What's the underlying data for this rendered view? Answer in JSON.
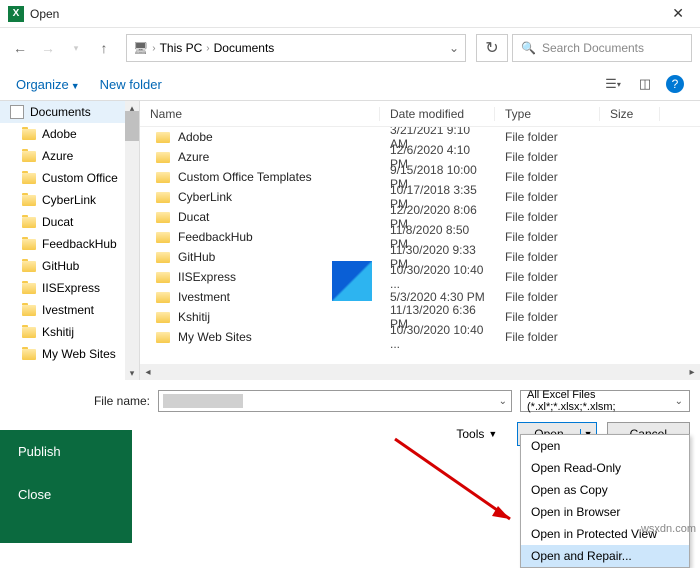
{
  "title": "Open",
  "breadcrumb": {
    "root": "This PC",
    "current": "Documents"
  },
  "search_placeholder": "Search Documents",
  "toolbar": {
    "organize": "Organize",
    "new_folder": "New folder"
  },
  "sidebar": {
    "root": "Documents",
    "items": [
      "Adobe",
      "Azure",
      "Custom Office",
      "CyberLink",
      "Ducat",
      "FeedbackHub",
      "GitHub",
      "IISExpress",
      "Ivestment",
      "Kshitij",
      "My Web Sites"
    ]
  },
  "columns": {
    "name": "Name",
    "date": "Date modified",
    "type": "Type",
    "size": "Size"
  },
  "rows": [
    {
      "name": "Adobe",
      "date": "3/21/2021 9:10 AM",
      "type": "File folder"
    },
    {
      "name": "Azure",
      "date": "12/6/2020 4:10 PM",
      "type": "File folder"
    },
    {
      "name": "Custom Office Templates",
      "date": "9/15/2018 10:00 PM",
      "type": "File folder"
    },
    {
      "name": "CyberLink",
      "date": "10/17/2018 3:35 PM",
      "type": "File folder"
    },
    {
      "name": "Ducat",
      "date": "12/20/2020 8:06 PM",
      "type": "File folder"
    },
    {
      "name": "FeedbackHub",
      "date": "11/8/2020 8:50 PM",
      "type": "File folder"
    },
    {
      "name": "GitHub",
      "date": "11/30/2020 9:33 PM",
      "type": "File folder"
    },
    {
      "name": "IISExpress",
      "date": "10/30/2020 10:40 ...",
      "type": "File folder"
    },
    {
      "name": "Ivestment",
      "date": "5/3/2020 4:30 PM",
      "type": "File folder"
    },
    {
      "name": "Kshitij",
      "date": "11/13/2020 6:36 PM",
      "type": "File folder"
    },
    {
      "name": "My Web Sites",
      "date": "10/30/2020 10:40 ...",
      "type": "File folder"
    }
  ],
  "filename_label": "File name:",
  "filter": "All Excel Files (*.xl*;*.xlsx;*.xlsm;",
  "tools": "Tools",
  "open_btn": "Open",
  "cancel_btn": "Cancel",
  "backstage": {
    "publish": "Publish",
    "close": "Close"
  },
  "menu": [
    "Open",
    "Open Read-Only",
    "Open as Copy",
    "Open in Browser",
    "Open in Protected View",
    "Open and Repair..."
  ],
  "watermark": "wsxdn.com"
}
